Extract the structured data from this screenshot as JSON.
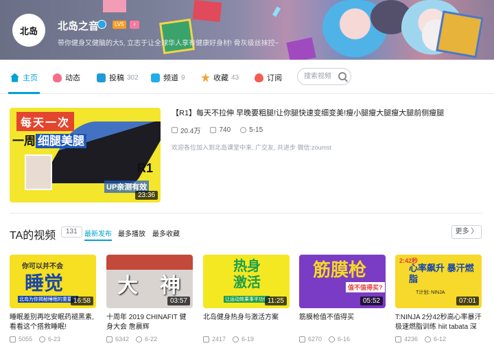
{
  "profile": {
    "avatar_text": "北岛",
    "name": "北岛之音",
    "level": "LV5",
    "gender_badge": "♀",
    "sign": "带你健身又健脑的大5, 立志于让全球华人享有健康好身材! 骨灰级丝袜控~"
  },
  "nav": {
    "items": [
      {
        "label": "主页",
        "count": ""
      },
      {
        "label": "动态",
        "count": ""
      },
      {
        "label": "投稿",
        "count": "302"
      },
      {
        "label": "频道",
        "count": "9"
      },
      {
        "label": "收藏",
        "count": "43"
      },
      {
        "label": "订阅",
        "count": ""
      }
    ],
    "search_placeholder": "搜索视频"
  },
  "featured": {
    "thumb_top": "每天一次",
    "thumb_mid_a": "一周",
    "thumb_mid_b": "细腿美腿",
    "thumb_r1": "R1",
    "thumb_up": "UP亲测有效",
    "duration": "23:36",
    "title": "【R1】每天不拉伸 早晚要粗腿!让你腿快速变细变美!瘦小腿瘦大腿瘦大腿前侧瘦腿",
    "plays": "20.4万",
    "comments": "740",
    "date": "5-15",
    "desc": "欢迎各位加入到北岛课堂中来, 广交友, 共进步 微信:zoumst"
  },
  "videos_section": {
    "title": "TA的视频",
    "count": "131",
    "tabs": [
      "最新发布",
      "最多播放",
      "最多收藏"
    ],
    "more_label": "更多 〉"
  },
  "videos": [
    {
      "thumb_a": "你可以并不会",
      "thumb_b": "睡觉",
      "thumb_c": "北岛为你揭秘睡眠的重要性",
      "duration": "16:58",
      "title": "睡眠差别再吃安眠药褪黑素, 看看这个搭救睡眠!",
      "plays": "5055",
      "date": "6-23"
    },
    {
      "thumb_a": "大",
      "thumb_b": "神",
      "thumb_c": "",
      "duration": "03:57",
      "title": "十周年 2019 CHINAFIT 健身大会 詹晨辉",
      "plays": "6342",
      "date": "6-22"
    },
    {
      "thumb_a": "热身激活",
      "thumb_b": "",
      "thumb_c": "让运动效果事半功倍",
      "duration": "11:25",
      "title": "北岛健身热身与激活方案",
      "plays": "2417",
      "date": "6-19"
    },
    {
      "thumb_a": "筋膜枪",
      "thumb_b": "值不值得买?",
      "thumb_c": "",
      "duration": "05:52",
      "title": "筋膜枪值不值得买",
      "plays": "6270",
      "date": "6-16"
    },
    {
      "thumb_a": "2:42秒",
      "thumb_b": "心率飙升 暴汗燃脂",
      "thumb_c": "T计划: NINJA",
      "duration": "07:01",
      "title": "T:NINJA 2分42秒高心率暴汗极速燃脂训练 hiit tabata 深",
      "plays": "4236",
      "date": "6-12"
    }
  ]
}
